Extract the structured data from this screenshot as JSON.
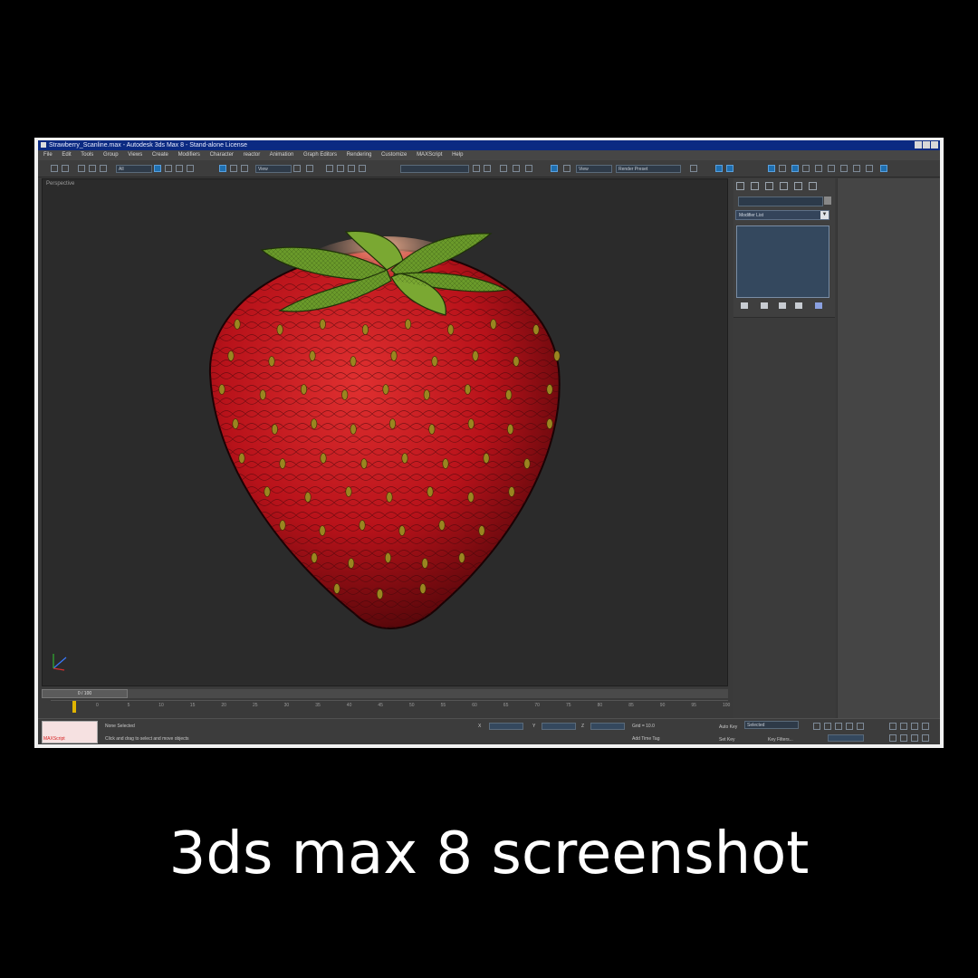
{
  "window": {
    "title": "Strawberry_Scanline.max  -  Autodesk 3ds Max 8  -  Stand-alone License"
  },
  "menu": [
    "File",
    "Edit",
    "Tools",
    "Group",
    "Views",
    "Create",
    "Modifiers",
    "Character",
    "reactor",
    "Animation",
    "Graph Editors",
    "Rendering",
    "Customize",
    "MAXScript",
    "Help"
  ],
  "toolbar": {
    "selection_filter": "All",
    "ref_coord": "View",
    "named_selection": "",
    "render_type": "View",
    "render_preset": "Render Preset"
  },
  "viewport": {
    "label": "Perspective"
  },
  "command_panel": {
    "modifier_list": "Modifier List"
  },
  "timeline": {
    "frame_display": "0 / 100",
    "ticks": [
      "0",
      "5",
      "10",
      "15",
      "20",
      "25",
      "30",
      "35",
      "40",
      "45",
      "50",
      "55",
      "60",
      "65",
      "70",
      "75",
      "80",
      "85",
      "90",
      "95",
      "100"
    ]
  },
  "status": {
    "maxscript_label": "MAXScript",
    "selection": "None Selected",
    "prompt": "Click and drag to select and move objects",
    "x_label": "X",
    "y_label": "Y",
    "z_label": "Z",
    "grid": "Grid = 10.0",
    "add_time_tag": "Add Time Tag",
    "auto_key": "Auto Key",
    "set_key": "Set Key",
    "selected_dropdown": "Selected",
    "key_filters": "Key Filters..."
  },
  "caption": "3ds max 8 screenshot",
  "colors": {
    "background": "#000000",
    "viewport": "#2b2b2b",
    "strawberry": "#c8141a",
    "leaves": "#6a9a2a",
    "seeds": "#a08a20",
    "title_bar": "#0b2a82"
  }
}
